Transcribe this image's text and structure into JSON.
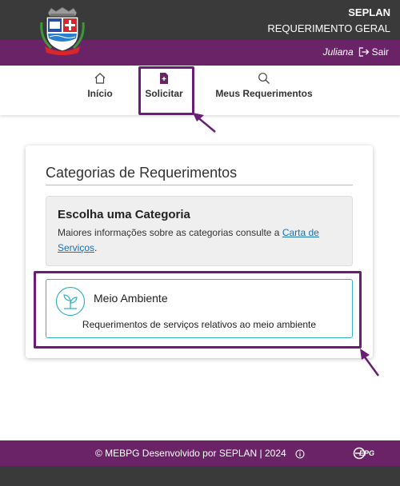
{
  "header": {
    "system_name": "SEPLAN",
    "system_subtitle": "REQUERIMENTO GERAL",
    "logo_icon": "coat-of-arms-icon"
  },
  "user": {
    "name": "Juliana",
    "logout_label": "Sair",
    "logout_icon": "logout-icon"
  },
  "nav": {
    "items": [
      {
        "label": "Início",
        "icon": "home-icon"
      },
      {
        "label": "Solicitar",
        "icon": "file-plus-icon",
        "highlighted": true
      },
      {
        "label": "Meus Requerimentos",
        "icon": "search-icon"
      }
    ]
  },
  "content": {
    "title": "Categorias de Requerimentos",
    "info": {
      "title": "Escolha uma Categoria",
      "text": "Maiores informações sobre as categorias consulte a ",
      "link_text": "Carta de Serviços",
      "text_end": "."
    },
    "category": {
      "name": "Meio Ambiente",
      "description": "Requerimentos de serviços relativos ao meio ambiente",
      "icon": "seedling-icon",
      "highlighted": true
    }
  },
  "footer": {
    "text": "© MEBPG Desenvolvido por SEPLAN | 2024",
    "info_icon": "info-icon",
    "brand": "EPG"
  },
  "colors": {
    "header_dark": "#3a3a3a",
    "brand_purple": "#6b2368",
    "highlight_purple": "#6a1c77",
    "category_border": "#36b3c8",
    "link": "#1a6fb5"
  }
}
